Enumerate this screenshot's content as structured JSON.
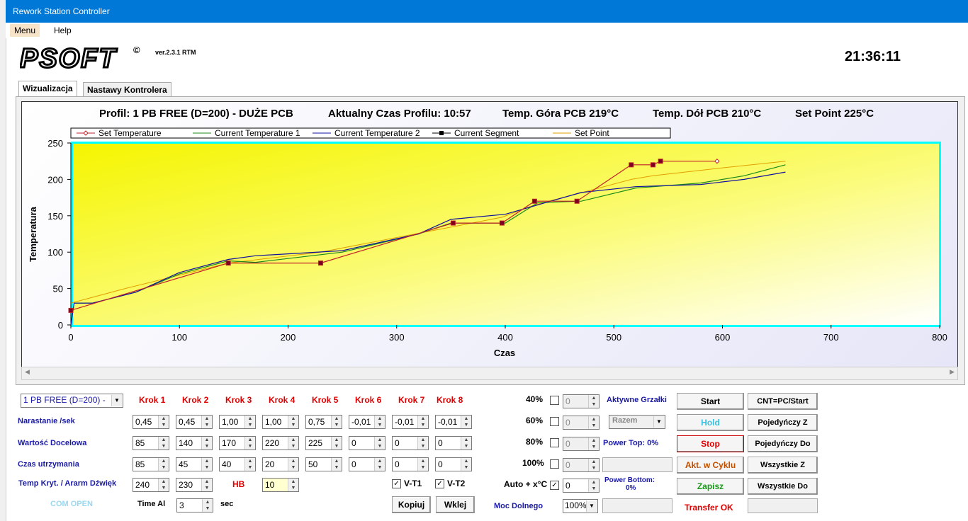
{
  "window": {
    "title": "Rework Station Controller"
  },
  "menu": {
    "items": [
      "Menu",
      "Help"
    ]
  },
  "header": {
    "logo": "PSOFT",
    "version": "ver.2.3.1 RTM",
    "clock": "21:36:11"
  },
  "tabs": [
    "Wizualizacja",
    "Nastawy Kontrolera"
  ],
  "status_line": {
    "profile": "Profil: 1 PB FREE (D=200) - DUŻE PCB",
    "time": "Aktualny Czas Profilu: 10:57",
    "top": "Temp. Góra PCB  219°C",
    "bottom": "Temp. Dół PCB  210°C",
    "setpoint": "Set Point 225°C"
  },
  "chart_data": {
    "type": "line",
    "xlabel": "Czas",
    "ylabel": "Temperatura",
    "xlim": [
      0,
      800
    ],
    "ylim": [
      0,
      250
    ],
    "x_ticks": [
      0,
      100,
      200,
      300,
      400,
      500,
      600,
      700,
      800
    ],
    "y_ticks": [
      0,
      50,
      100,
      150,
      200,
      250
    ],
    "legend": [
      "Set Temperature",
      "Current Temperature 1",
      "Current Temperature 2",
      "Current Segment",
      "Set Point"
    ],
    "legend_position": "top",
    "colors": {
      "set_temp": "#c0202a",
      "cur1": "#1a8a1a",
      "cur2": "#1010a0",
      "segment": "#000000",
      "set_point": "#e0a000"
    },
    "series": [
      {
        "name": "Set Temperature",
        "x": [
          0,
          145,
          230,
          352,
          397,
          427,
          466,
          516,
          536,
          543,
          595
        ],
        "y": [
          20,
          85,
          85,
          140,
          140,
          170,
          170,
          220,
          220,
          225,
          225
        ]
      },
      {
        "name": "Current Temperature 1",
        "x": [
          0,
          3,
          20,
          60,
          100,
          145,
          170,
          250,
          320,
          350,
          400,
          430,
          470,
          520,
          580,
          620,
          658
        ],
        "y": [
          0,
          30,
          30,
          45,
          70,
          88,
          86,
          100,
          125,
          140,
          140,
          168,
          170,
          188,
          195,
          205,
          220
        ]
      },
      {
        "name": "Current Temperature 2",
        "x": [
          0,
          3,
          20,
          60,
          100,
          145,
          170,
          250,
          320,
          350,
          400,
          430,
          470,
          520,
          580,
          620,
          658
        ],
        "y": [
          0,
          30,
          30,
          45,
          72,
          90,
          95,
          102,
          125,
          145,
          152,
          165,
          182,
          190,
          193,
          200,
          210
        ]
      },
      {
        "name": "Set Point",
        "x": [
          0,
          50,
          145,
          230,
          352,
          397,
          427,
          466,
          516,
          536,
          595,
          658
        ],
        "y": [
          30,
          50,
          85,
          100,
          135,
          148,
          165,
          180,
          200,
          205,
          215,
          225
        ]
      }
    ]
  },
  "profile_select": "1 PB FREE (D=200) -",
  "steps": {
    "headers": [
      "Krok 1",
      "Krok 2",
      "Krok 3",
      "Krok 4",
      "Krok 5",
      "Krok 6",
      "Krok 7",
      "Krok 8"
    ],
    "rows": [
      {
        "label": "Narastanie /sek",
        "values": [
          "0,45",
          "0,45",
          "1,00",
          "1,00",
          "0,75",
          "-0,01",
          "-0,01",
          "-0,01"
        ]
      },
      {
        "label": "Wartość Docelowa",
        "values": [
          "85",
          "140",
          "170",
          "220",
          "225",
          "0",
          "0",
          "0"
        ]
      },
      {
        "label": "Czas utrzymania",
        "values": [
          "85",
          "45",
          "40",
          "20",
          "50",
          "0",
          "0",
          "0"
        ]
      }
    ]
  },
  "alarm": {
    "label": "Temp Kryt. / Ararm Dźwięk",
    "v1": "240",
    "v2": "230",
    "hb_label": "HB",
    "hb_value": "10"
  },
  "com_status": "COM OPEN",
  "timeal": {
    "label": "Time Al",
    "value": "3",
    "unit": "sec"
  },
  "vt": {
    "vt1": "V-T1",
    "vt2": "V-T2"
  },
  "copy_paste": {
    "copy": "Kopiuj",
    "paste": "Wklej"
  },
  "power": {
    "levels": [
      "40%",
      "60%",
      "80%",
      "100%"
    ],
    "level_values": [
      "0",
      "0",
      "0",
      "0"
    ],
    "active_heaters": "Aktywne Grzałki",
    "together": "Razem",
    "power_top": "Power Top: 0%",
    "power_bottom_1": "Power Bottom:",
    "power_bottom_2": "0%",
    "auto": "Auto + x°C",
    "auto_value": "0",
    "moc_label": "Moc Dolnego",
    "moc_value": "100%"
  },
  "buttons": {
    "start": "Start",
    "hold": "Hold",
    "stop": "Stop",
    "cycle": "Akt. w Cyklu",
    "save": "Zapisz",
    "cnt": "CNT=PC/Start",
    "single_z": "Pojedyńczy Z",
    "single_do": "Pojedyńczy Do",
    "all_z": "Wszystkie Z",
    "all_do": "Wszystkie Do"
  },
  "transfer": "Transfer OK"
}
